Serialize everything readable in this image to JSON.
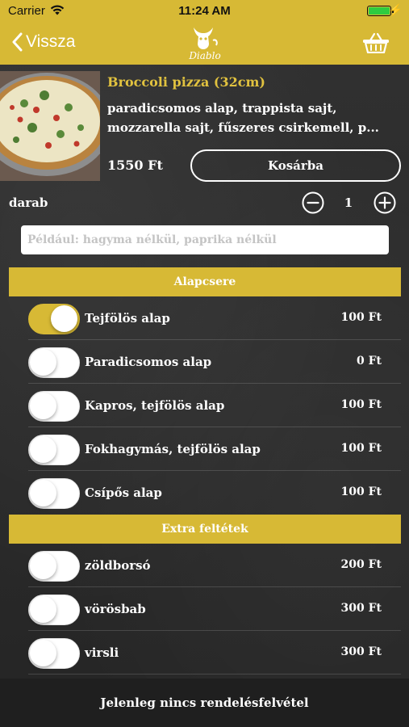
{
  "status": {
    "carrier": "Carrier",
    "time": "11:24 AM"
  },
  "nav": {
    "back_label": "Vissza",
    "logo_text": "Diablo"
  },
  "product": {
    "title": "Broccoli pizza (32cm)",
    "description": "paradicsomos alap, trappista sajt, mozzarella sajt, fűszeres csirkemell, p...",
    "price": "1550 Ft",
    "cart_button": "Kosárba",
    "qty_label": "darab",
    "qty_value": "1",
    "note_placeholder": "Például: hagyma nélkül, paprika nélkül"
  },
  "sections": [
    {
      "title": "Alapcsere",
      "options": [
        {
          "name": "Tejfölös alap",
          "price": "100 Ft",
          "on": true
        },
        {
          "name": "Paradicsomos alap",
          "price": "0 Ft",
          "on": false
        },
        {
          "name": "Kapros, tejfölös alap",
          "price": "100 Ft",
          "on": false
        },
        {
          "name": "Fokhagymás, tejfölös alap",
          "price": "100 Ft",
          "on": false
        },
        {
          "name": "Csípős alap",
          "price": "100 Ft",
          "on": false
        }
      ]
    },
    {
      "title": "Extra feltétek",
      "options": [
        {
          "name": "zöldborsó",
          "price": "200 Ft",
          "on": false
        },
        {
          "name": "vörösbab",
          "price": "300 Ft",
          "on": false
        },
        {
          "name": "virsli",
          "price": "300 Ft",
          "on": false
        }
      ]
    }
  ],
  "footer": {
    "message": "Jelenleg nincs rendelésfelvétel"
  },
  "colors": {
    "accent": "#d7b935",
    "title": "#e1c23f",
    "background": "#2b2b2b"
  },
  "icons": [
    "wifi-icon",
    "battery-icon",
    "chevron-left-icon",
    "diablo-logo",
    "basket-icon",
    "minus-circle-icon",
    "plus-circle-icon"
  ]
}
